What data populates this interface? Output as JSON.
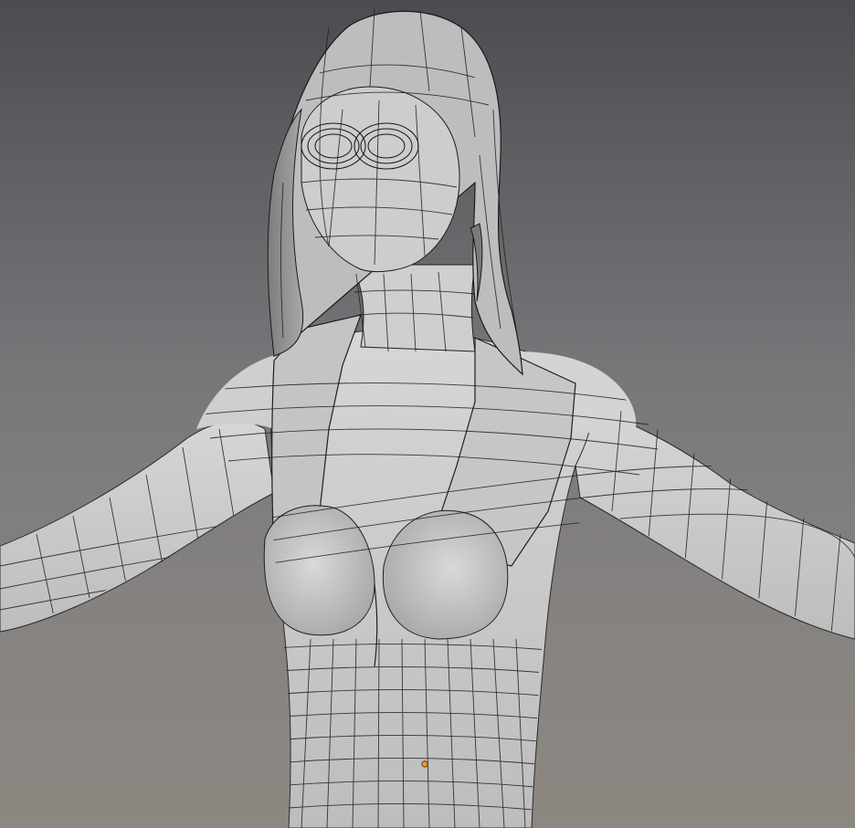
{
  "viewport": {
    "background_top": "#4a4c51",
    "background_bottom": "#8d8781",
    "mesh_fill": "#c9c9c9",
    "mesh_shadow": "#8e8e8e",
    "wire_color": "#1a1a1a",
    "origin_color": "#ff9a1a",
    "object_origin_icon": "origin-point-icon"
  }
}
